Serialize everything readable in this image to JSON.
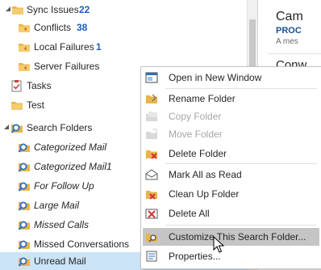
{
  "folders": {
    "sync_issues": {
      "label": "Sync Issues",
      "count": "22"
    },
    "conflicts": {
      "label": "Conflicts",
      "count": "38"
    },
    "local_failures": {
      "label": "Local Failures",
      "count": "1"
    },
    "server_failures": {
      "label": "Server Failures"
    },
    "tasks": {
      "label": "Tasks"
    },
    "test": {
      "label": "Test"
    },
    "search_folders": {
      "label": "Search Folders"
    },
    "search_items": [
      {
        "label": "Categorized Mail"
      },
      {
        "label": "Categorized Mail1"
      },
      {
        "label": "For Follow Up"
      },
      {
        "label": "Large Mail"
      },
      {
        "label": "Missed Calls"
      },
      {
        "label": "Missed Conversations"
      },
      {
        "label": "Unread Mail"
      }
    ]
  },
  "message_preview": {
    "sender": "Cam",
    "subject": "PROC",
    "preview": "A mes",
    "sender2": "Conw"
  },
  "context_menu": {
    "items": [
      {
        "label": "Open in New Window",
        "icon": "open-new-window-icon",
        "enabled": true
      },
      {
        "label": "Rename Folder",
        "icon": "rename-folder-icon",
        "enabled": true
      },
      {
        "label": "Copy Folder",
        "icon": "copy-folder-icon",
        "enabled": false
      },
      {
        "label": "Move Folder",
        "icon": "move-folder-icon",
        "enabled": false
      },
      {
        "label": "Delete Folder",
        "icon": "delete-folder-icon",
        "enabled": true
      },
      {
        "label": "Mark All as Read",
        "icon": "mark-all-read-icon",
        "enabled": true
      },
      {
        "label": "Clean Up Folder",
        "icon": "clean-up-folder-icon",
        "enabled": true
      },
      {
        "label": "Delete All",
        "icon": "delete-all-icon",
        "enabled": true
      },
      {
        "label": "Customize This Search Folder...",
        "icon": "customize-search-folder-icon",
        "enabled": true,
        "highlighted": true
      },
      {
        "label": "Properties...",
        "icon": "properties-icon",
        "enabled": true
      }
    ]
  },
  "colors": {
    "accent_blue": "#1e5fb5",
    "selection": "#cce4f7",
    "menu_highlight": "#c5c5c5",
    "folder_yellow": "#e8b54a"
  }
}
